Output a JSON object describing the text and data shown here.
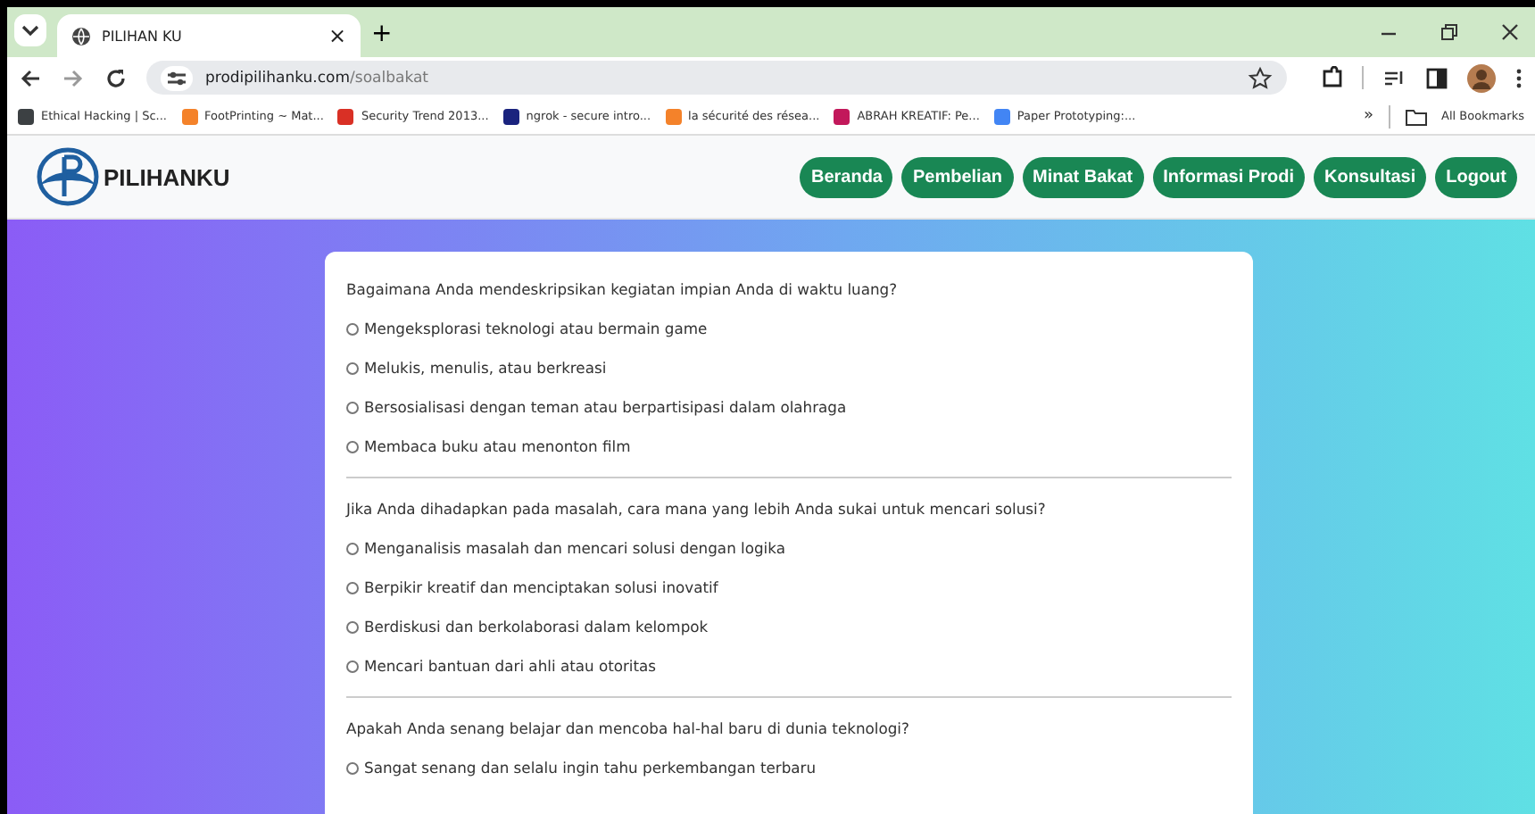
{
  "browser": {
    "tab_title": "PILIHAN KU",
    "tab_close": "×",
    "new_tab": "+",
    "url_host": "prodipilihanku.com",
    "url_path": "/soalbakat",
    "bookmarks": [
      {
        "label": "Ethical Hacking | Sc...",
        "color": "#3c4043"
      },
      {
        "label": "FootPrinting ~ Mat...",
        "color": "#f4822a"
      },
      {
        "label": "Security Trend 2013...",
        "color": "#d93025"
      },
      {
        "label": "ngrok - secure intro...",
        "color": "#1a237e"
      },
      {
        "label": "la sécurité des résea...",
        "color": "#f4822a"
      },
      {
        "label": "ABRAH KREATIF: Pe...",
        "color": "#c2185b"
      },
      {
        "label": "Paper Prototyping:...",
        "color": "#4285f4"
      }
    ],
    "more": "»",
    "all_bookmarks": "All Bookmarks"
  },
  "navbar": {
    "brand": "PILIHANKU",
    "links": [
      {
        "label": "Beranda"
      },
      {
        "label": "Pembelian"
      },
      {
        "label": "Minat Bakat"
      },
      {
        "label": "Informasi Prodi"
      },
      {
        "label": "Konsultasi"
      },
      {
        "label": "Logout"
      }
    ]
  },
  "questions": [
    {
      "text": "Bagaimana Anda mendeskripsikan kegiatan impian Anda di waktu luang?",
      "options": [
        {
          "label": "Mengeksplorasi teknologi atau bermain game",
          "selected": false
        },
        {
          "label": "Melukis, menulis, atau berkreasi",
          "selected": false
        },
        {
          "label": "Bersosialisasi dengan teman atau berpartisipasi dalam olahraga",
          "selected": false
        },
        {
          "label": "Membaca buku atau menonton film",
          "selected": false
        }
      ]
    },
    {
      "text": "Jika Anda dihadapkan pada masalah, cara mana yang lebih Anda sukai untuk mencari solusi?",
      "options": [
        {
          "label": "Menganalisis masalah dan mencari solusi dengan logika",
          "selected": false
        },
        {
          "label": "Berpikir kreatif dan menciptakan solusi inovatif",
          "selected": false
        },
        {
          "label": "Berdiskusi dan berkolaborasi dalam kelompok",
          "selected": false
        },
        {
          "label": "Mencari bantuan dari ahli atau otoritas",
          "selected": false
        }
      ]
    },
    {
      "text": "Apakah Anda senang belajar dan mencoba hal-hal baru di dunia teknologi?",
      "options": [
        {
          "label": "Sangat senang dan selalu ingin tahu perkembangan terbaru",
          "selected": false
        }
      ]
    }
  ]
}
